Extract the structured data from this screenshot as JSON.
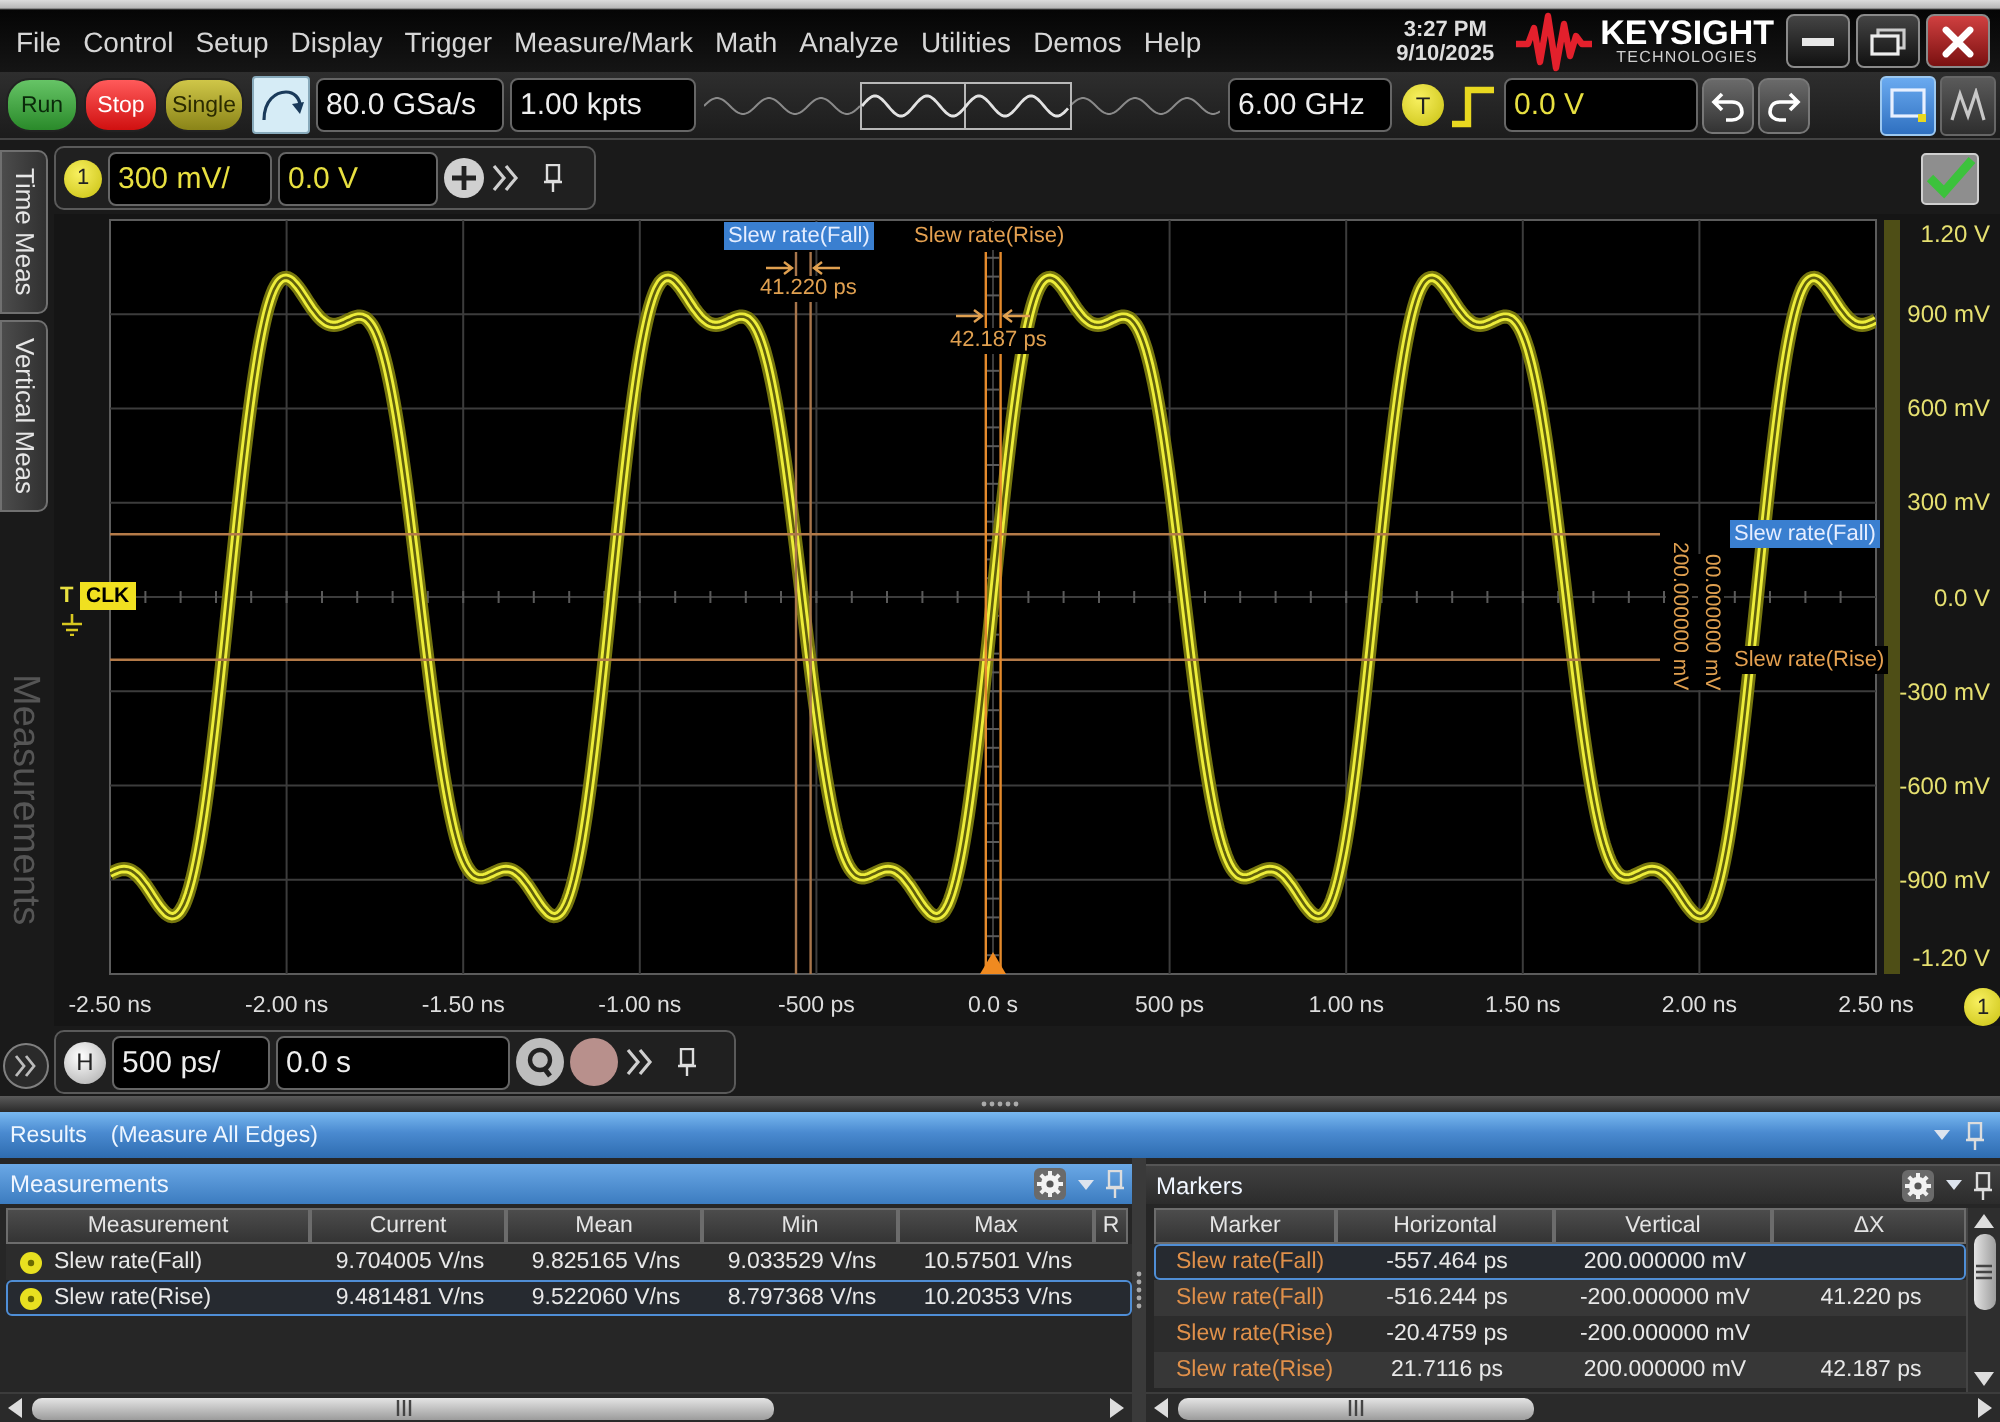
{
  "menu_bar": {
    "items": [
      "File",
      "Control",
      "Setup",
      "Display",
      "Trigger",
      "Measure/Mark",
      "Math",
      "Analyze",
      "Utilities",
      "Demos",
      "Help"
    ],
    "time": "3:27 PM",
    "date": "9/10/2025",
    "logo": {
      "wordmark": "KEYSIGHT",
      "tagline": "TECHNOLOGIES"
    }
  },
  "toolbar": {
    "run_controls": [
      {
        "label": "Run",
        "kind": "run"
      },
      {
        "label": "Stop",
        "kind": "stop"
      },
      {
        "label": "Single",
        "kind": "single"
      }
    ],
    "sample_rate": "80.0 GSa/s",
    "memory_depth": "1.00 kpts",
    "bandwidth": "6.00 GHz",
    "trigger_badge": "T",
    "trigger_level": "0.0 V",
    "view_modes": [
      {
        "selected": true
      },
      {
        "selected": false
      }
    ]
  },
  "side_tabs": [
    "Time Meas",
    "Vertical Meas"
  ],
  "collapsed_panel": {
    "label": "Measurements"
  },
  "channel_bar": {
    "badge": "1",
    "scale": "300 mV/",
    "offset": "0.0 V"
  },
  "plot": {
    "y_ticks": [
      "1.20 V",
      "900 mV",
      "600 mV",
      "300 mV",
      "0.0 V",
      "-300 mV",
      "-600 mV",
      "-900 mV",
      "-1.20 V"
    ],
    "x_ticks": [
      "-2.50 ns",
      "-2.00 ns",
      "-1.50 ns",
      "-1.00 ns",
      "-500 ps",
      "0.0 s",
      "500 ps",
      "1.00 ns",
      "1.50 ns",
      "2.00 ns",
      "2.50 ns"
    ],
    "axis_badge": "1",
    "trigger_marker": "T",
    "channel_label": "CLK",
    "time_markers": [
      {
        "label": "Slew rate(Fall)",
        "selected": true,
        "delta": "41.220 ps"
      },
      {
        "label": "Slew rate(Rise)",
        "selected": false,
        "delta": "42.187 ps"
      }
    ],
    "level_markers": [
      {
        "label": "Slew rate(Fall)",
        "selected": true
      },
      {
        "label": "Slew rate(Rise)",
        "selected": false
      }
    ],
    "level_readouts": [
      "200.000000 mV",
      "00.000000 mV"
    ]
  },
  "horizontal_bar": {
    "badge": "H",
    "scale": "500 ps/",
    "position": "0.0 s"
  },
  "results": {
    "title": "Results",
    "subtitle": "(Measure All Edges)",
    "measurements": {
      "title": "Measurements",
      "columns": [
        "Measurement",
        "Current",
        "Mean",
        "Min",
        "Max",
        "R"
      ],
      "rows": [
        {
          "selected": false,
          "measurement": "Slew rate(Fall)",
          "current": "9.704005 V/ns",
          "mean": "9.825165 V/ns",
          "min": "9.033529 V/ns",
          "max": "10.57501 V/ns"
        },
        {
          "selected": true,
          "measurement": "Slew rate(Rise)",
          "current": "9.481481 V/ns",
          "mean": "9.522060 V/ns",
          "min": "8.797368 V/ns",
          "max": "10.20353 V/ns"
        }
      ]
    },
    "markers": {
      "title": "Markers",
      "columns": [
        "Marker",
        "Horizontal",
        "Vertical",
        "ΔX"
      ],
      "rows": [
        {
          "selected": true,
          "marker": "Slew rate(Fall)",
          "horizontal": "-557.464 ps",
          "vertical": "200.000000 mV"
        },
        {
          "selected": false,
          "marker": "Slew rate(Fall)",
          "horizontal": "-516.244 ps",
          "vertical": "-200.000000 mV",
          "delta_x": "41.220 ps"
        },
        {
          "selected": false,
          "marker": "Slew rate(Rise)",
          "horizontal": "-20.4759 ps",
          "vertical": "-200.000000 mV"
        },
        {
          "selected": false,
          "marker": "Slew rate(Rise)",
          "horizontal": "21.7116 ps",
          "vertical": "200.000000 mV",
          "delta_x": "42.187 ps"
        }
      ]
    }
  }
}
